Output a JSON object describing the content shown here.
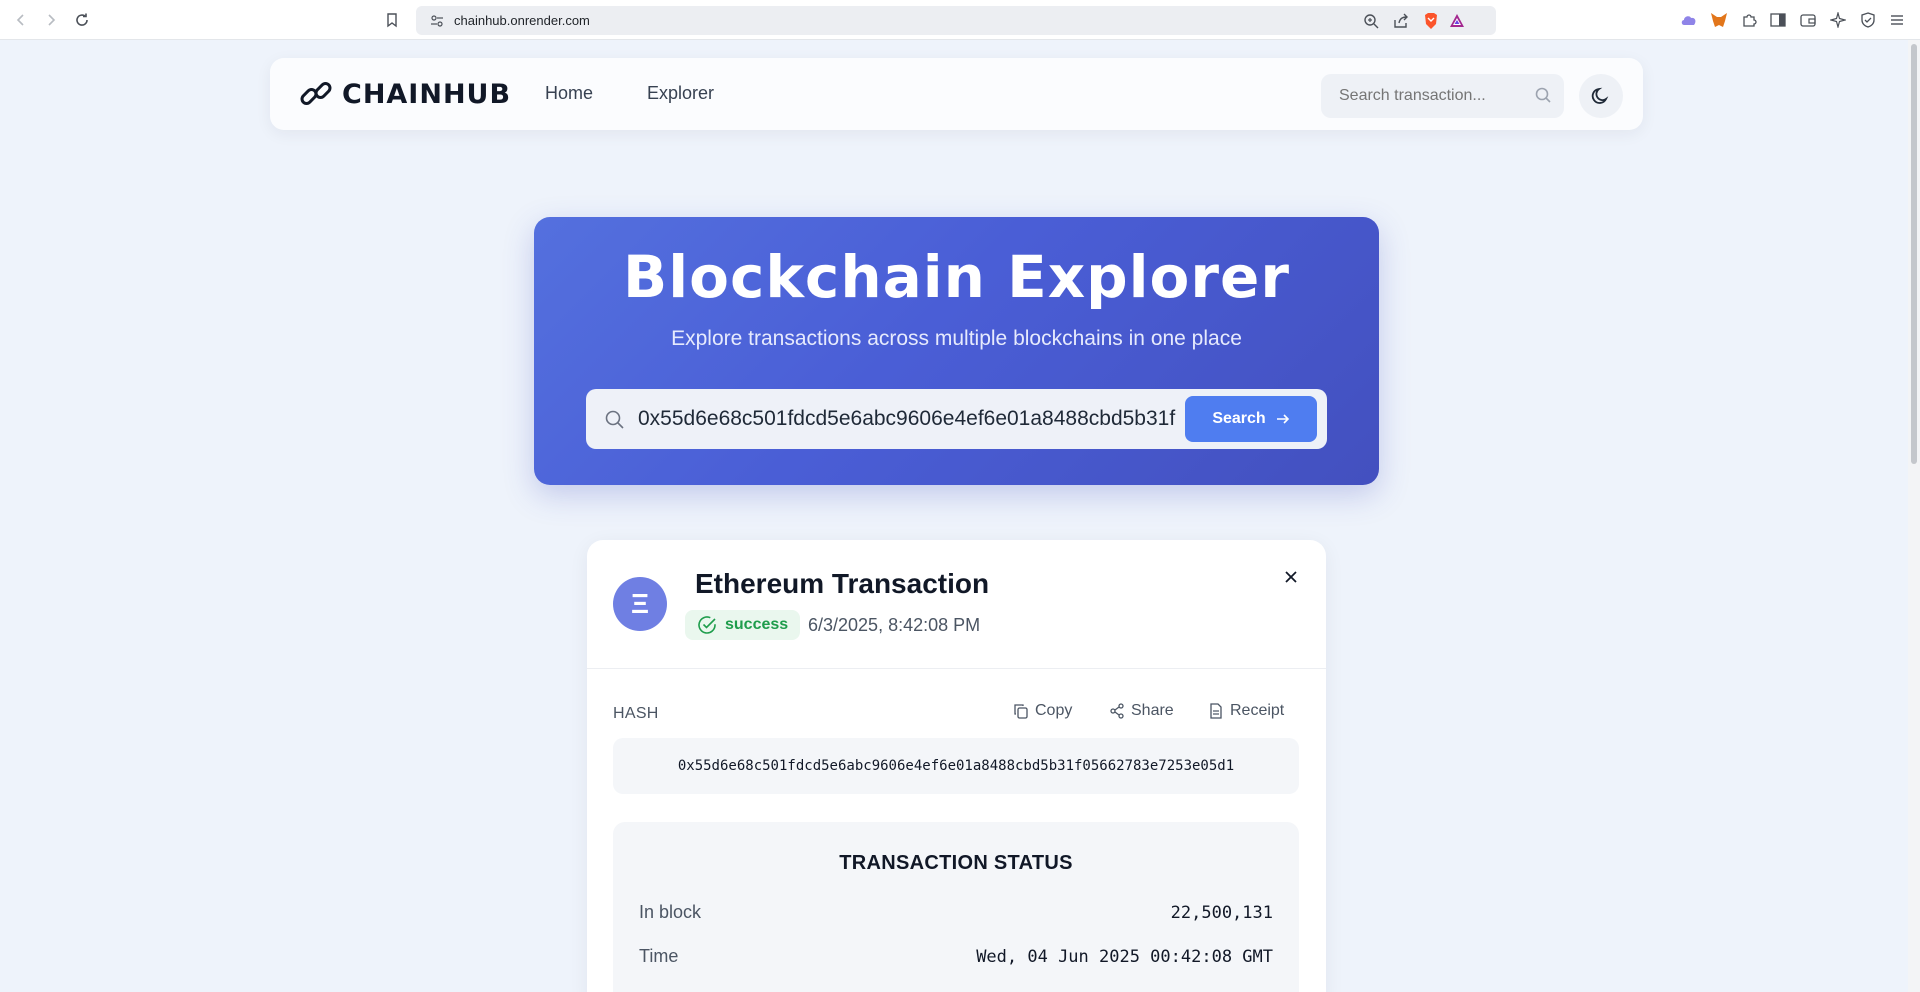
{
  "browser": {
    "url": "chainhub.onrender.com"
  },
  "navbar": {
    "logo_text": "CHAINHUB",
    "links": [
      "Home",
      "Explorer"
    ],
    "search_placeholder": "Search transaction..."
  },
  "hero": {
    "title": "Blockchain Explorer",
    "subtitle": "Explore transactions across multiple blockchains in one place",
    "search_value": "0x55d6e68c501fdcd5e6abc9606e4ef6e01a8488cbd5b31f",
    "search_button": "Search"
  },
  "transaction": {
    "title": "Ethereum Transaction",
    "avatar_glyph": "Ξ",
    "status": "success",
    "timestamp": "6/3/2025, 8:42:08 PM",
    "hash_label": "HASH",
    "actions": [
      "Copy",
      "Share",
      "Receipt"
    ],
    "hash": "0x55d6e68c501fdcd5e6abc9606e4ef6e01a8488cbd5b31f05662783e7253e05d1",
    "status_section": {
      "title": "TRANSACTION STATUS",
      "rows": [
        {
          "label": "In block",
          "value": "22,500,131"
        },
        {
          "label": "Time",
          "value": "Wed, 04 Jun 2025 00:42:08 GMT"
        }
      ]
    }
  },
  "colors": {
    "accent": "#4f7df0",
    "hero_gradient_start": "#5470de",
    "hero_gradient_end": "#4350bf",
    "success": "#1f9d4c",
    "eth_avatar": "#6f7fe3"
  }
}
